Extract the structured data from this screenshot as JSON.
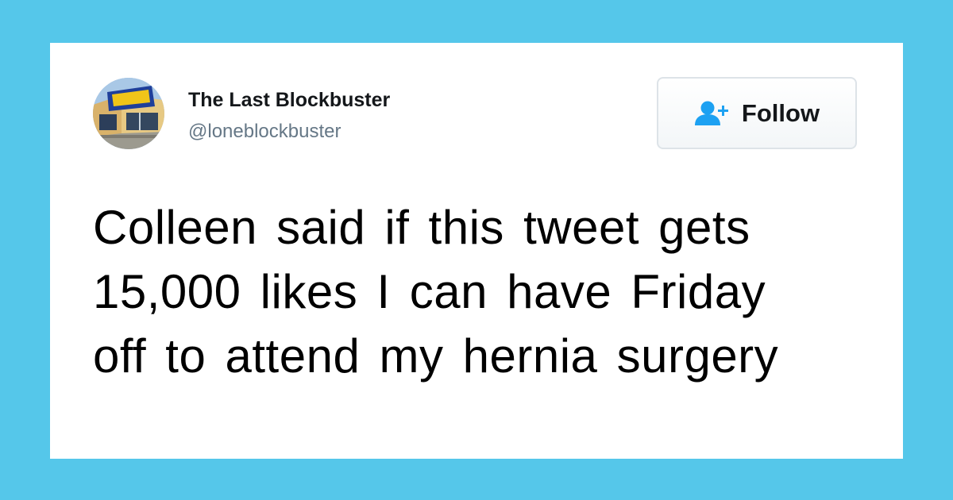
{
  "colors": {
    "background": "#55c7ea",
    "card": "#ffffff",
    "follow_icon": "#1da1f2",
    "handle": "#657786",
    "text": "#000000"
  },
  "account": {
    "display_name": "The Last Blockbuster",
    "handle": "@loneblockbuster",
    "avatar_icon": "blockbuster-store-avatar"
  },
  "follow_button": {
    "label": "Follow",
    "icon": "add-user-icon"
  },
  "tweet": {
    "lines": [
      "Colleen said if this tweet gets",
      "15,000 likes I can have Friday",
      "off to attend my hernia surgery"
    ]
  }
}
